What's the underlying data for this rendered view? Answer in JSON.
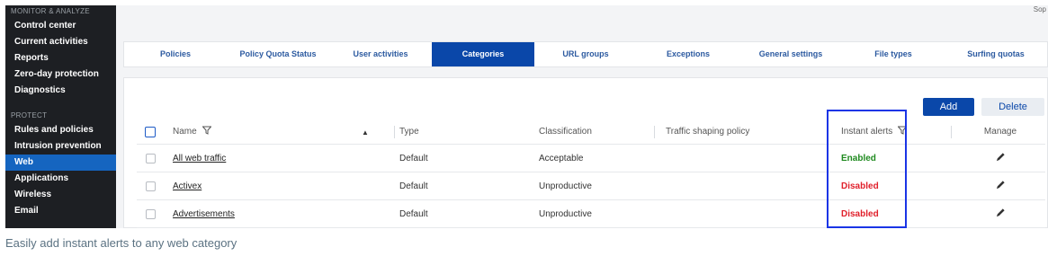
{
  "sidebar": {
    "monitor_label": "MONITOR & ANALYZE",
    "monitor_items": [
      "Control center",
      "Current activities",
      "Reports",
      "Zero-day protection",
      "Diagnostics"
    ],
    "protect_label": "PROTECT",
    "protect_items": [
      "Rules and policies",
      "Intrusion prevention",
      "Web",
      "Applications",
      "Wireless",
      "Email"
    ],
    "active_item": "Web"
  },
  "header": {
    "brand_fragment": "Sop"
  },
  "tabs": [
    "Policies",
    "Policy Quota Status",
    "User activities",
    "Categories",
    "URL groups",
    "Exceptions",
    "General settings",
    "File types",
    "Surfing quotas"
  ],
  "active_tab": "Categories",
  "actions": {
    "add": "Add",
    "delete": "Delete"
  },
  "table": {
    "columns": {
      "name": "Name",
      "type": "Type",
      "classification": "Classification",
      "traffic": "Traffic shaping policy",
      "alerts": "Instant alerts",
      "manage": "Manage"
    },
    "rows": [
      {
        "name": "All web traffic",
        "type": "Default",
        "classification": "Acceptable",
        "traffic": "",
        "alerts": "Enabled"
      },
      {
        "name": "Activex",
        "type": "Default",
        "classification": "Unproductive",
        "traffic": "",
        "alerts": "Disabled"
      },
      {
        "name": "Advertisements",
        "type": "Default",
        "classification": "Unproductive",
        "traffic": "",
        "alerts": "Disabled"
      }
    ]
  },
  "colors": {
    "accent": "#0a47a9",
    "enabled": "#1f8a1f",
    "disabled": "#e0202b",
    "highlight": "#1a35e6"
  },
  "caption": "Easily add instant alerts to any web category"
}
